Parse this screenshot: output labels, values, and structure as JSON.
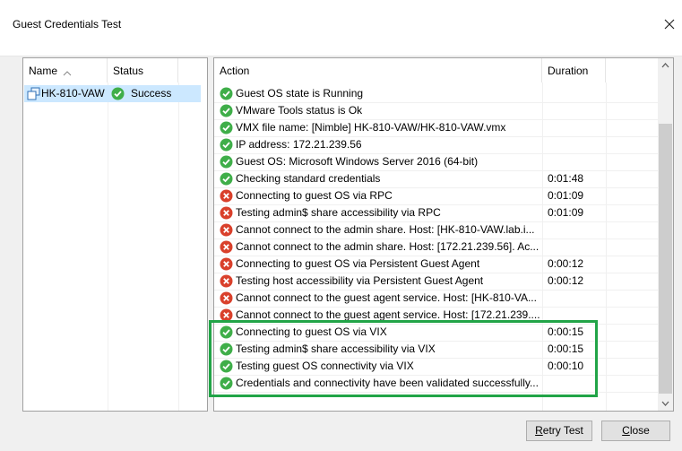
{
  "window": {
    "title": "Guest Credentials Test"
  },
  "left": {
    "columns": [
      "Name",
      "Status"
    ],
    "rows": [
      {
        "name": "HK-810-VAW",
        "status": "Success"
      }
    ]
  },
  "right": {
    "columns": [
      "Action",
      "Duration"
    ],
    "rows": [
      {
        "status": "success",
        "action": "Guest OS state is Running",
        "duration": ""
      },
      {
        "status": "success",
        "action": "VMware Tools status is Ok",
        "duration": ""
      },
      {
        "status": "success",
        "action": "VMX file name: [Nimble] HK-810-VAW/HK-810-VAW.vmx",
        "duration": ""
      },
      {
        "status": "success",
        "action": "IP address: 172.21.239.56",
        "duration": ""
      },
      {
        "status": "success",
        "action": "Guest OS: Microsoft Windows Server 2016 (64-bit)",
        "duration": ""
      },
      {
        "status": "success",
        "action": "Checking standard credentials",
        "duration": "0:01:48"
      },
      {
        "status": "error",
        "action": "Connecting to guest OS via RPC",
        "duration": "0:01:09"
      },
      {
        "status": "error",
        "action": "Testing admin$ share accessibility via RPC",
        "duration": "0:01:09"
      },
      {
        "status": "error",
        "action": "Cannot connect to the admin share. Host: [HK-810-VAW.lab.i...",
        "duration": ""
      },
      {
        "status": "error",
        "action": "Cannot connect to the admin share. Host: [172.21.239.56]. Ac...",
        "duration": ""
      },
      {
        "status": "error",
        "action": "Connecting to guest OS via Persistent Guest Agent",
        "duration": "0:00:12"
      },
      {
        "status": "error",
        "action": "Testing host accessibility via Persistent Guest Agent",
        "duration": "0:00:12"
      },
      {
        "status": "error",
        "action": "Cannot connect to the guest agent service. Host: [HK-810-VA...",
        "duration": ""
      },
      {
        "status": "error",
        "action": "Cannot connect to the guest agent service. Host: [172.21.239....",
        "duration": ""
      },
      {
        "status": "success",
        "action": "Connecting to guest OS via VIX",
        "duration": "0:00:15"
      },
      {
        "status": "success",
        "action": "Testing admin$ share accessibility via VIX",
        "duration": "0:00:15"
      },
      {
        "status": "success",
        "action": "Testing guest OS connectivity via VIX",
        "duration": "0:00:10"
      },
      {
        "status": "success",
        "action": "Credentials and connectivity have been validated successfully...",
        "duration": ""
      }
    ]
  },
  "buttons": {
    "retry": "Retry Test",
    "close": "Close"
  },
  "colors": {
    "success": "#3fae49",
    "error": "#d9402b",
    "highlight": "#21a447",
    "selection": "#cce8ff"
  },
  "icons": {
    "success": "check-circle-icon",
    "error": "x-circle-icon",
    "vm": "vm-icon",
    "sort": "sort-up-icon",
    "close": "close-icon"
  }
}
